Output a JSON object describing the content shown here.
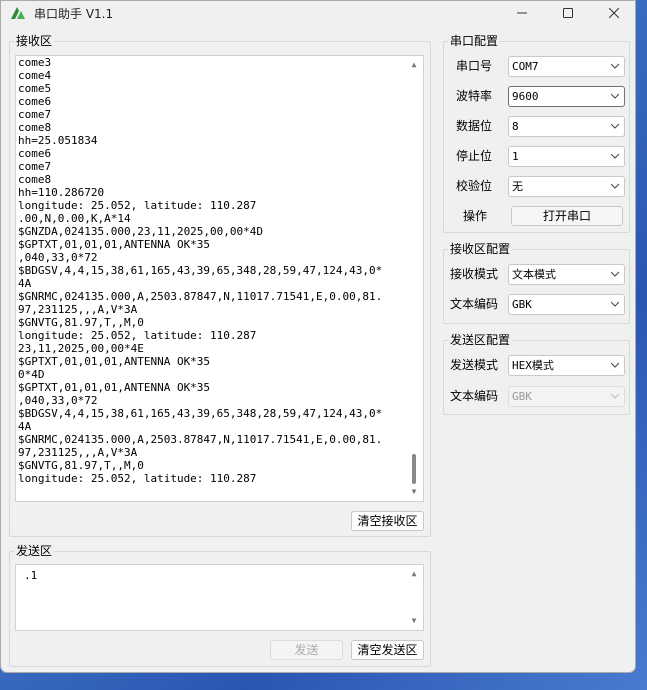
{
  "window": {
    "title": "串口助手 V1.1",
    "min": "—",
    "max": "☐",
    "close": "✕"
  },
  "recv": {
    "title": "接收区",
    "lines": [
      "come3",
      "come4",
      "come5",
      "come6",
      "come7",
      "come8",
      "hh=25.051834",
      "come6",
      "come7",
      "come8",
      "hh=110.286720",
      "longitude: 25.052, latitude: 110.287",
      ".00,N,0.00,K,A*14",
      "$GNZDA,024135.000,23,11,2025,00,00*4D",
      "$GPTXT,01,01,01,ANTENNA OK*35",
      ",040,33,0*72",
      "$BDGSV,4,4,15,38,61,165,43,39,65,348,28,59,47,124,43,0*",
      "4A",
      "$GNRMC,024135.000,A,2503.87847,N,11017.71541,E,0.00,81.",
      "97,231125,,,A,V*3A",
      "$GNVTG,81.97,T,,M,0",
      "longitude: 25.052, latitude: 110.287",
      "23,11,2025,00,00*4E",
      "$GPTXT,01,01,01,ANTENNA OK*35",
      "0*4D",
      "$GPTXT,01,01,01,ANTENNA OK*35",
      ",040,33,0*72",
      "$BDGSV,4,4,15,38,61,165,43,39,65,348,28,59,47,124,43,0*",
      "4A",
      "$GNRMC,024135.000,A,2503.87847,N,11017.71541,E,0.00,81.",
      "97,231125,,,A,V*3A",
      "$GNVTG,81.97,T,,M,0",
      "longitude: 25.052, latitude: 110.287"
    ],
    "clear_button": "清空接收区"
  },
  "send": {
    "title": "发送区",
    "text": ".1",
    "send_button": "发送",
    "clear_button": "清空发送区"
  },
  "serial_config": {
    "title": "串口配置",
    "port_label": "串口号",
    "port_value": "COM7",
    "baud_label": "波特率",
    "baud_value": "9600",
    "databits_label": "数据位",
    "databits_value": "8",
    "stopbits_label": "停止位",
    "stopbits_value": "1",
    "parity_label": "校验位",
    "parity_value": "无",
    "operation_label": "操作",
    "open_button": "打开串口"
  },
  "recv_config": {
    "title": "接收区配置",
    "mode_label": "接收模式",
    "mode_value": "文本模式",
    "encoding_label": "文本编码",
    "encoding_value": "GBK"
  },
  "send_config": {
    "title": "发送区配置",
    "mode_label": "发送模式",
    "mode_value": "HEX模式",
    "encoding_label": "文本编码",
    "encoding_value": "GBK"
  },
  "icons": {
    "app": "app-logo-icon",
    "chevron": "chevron-down-icon"
  }
}
